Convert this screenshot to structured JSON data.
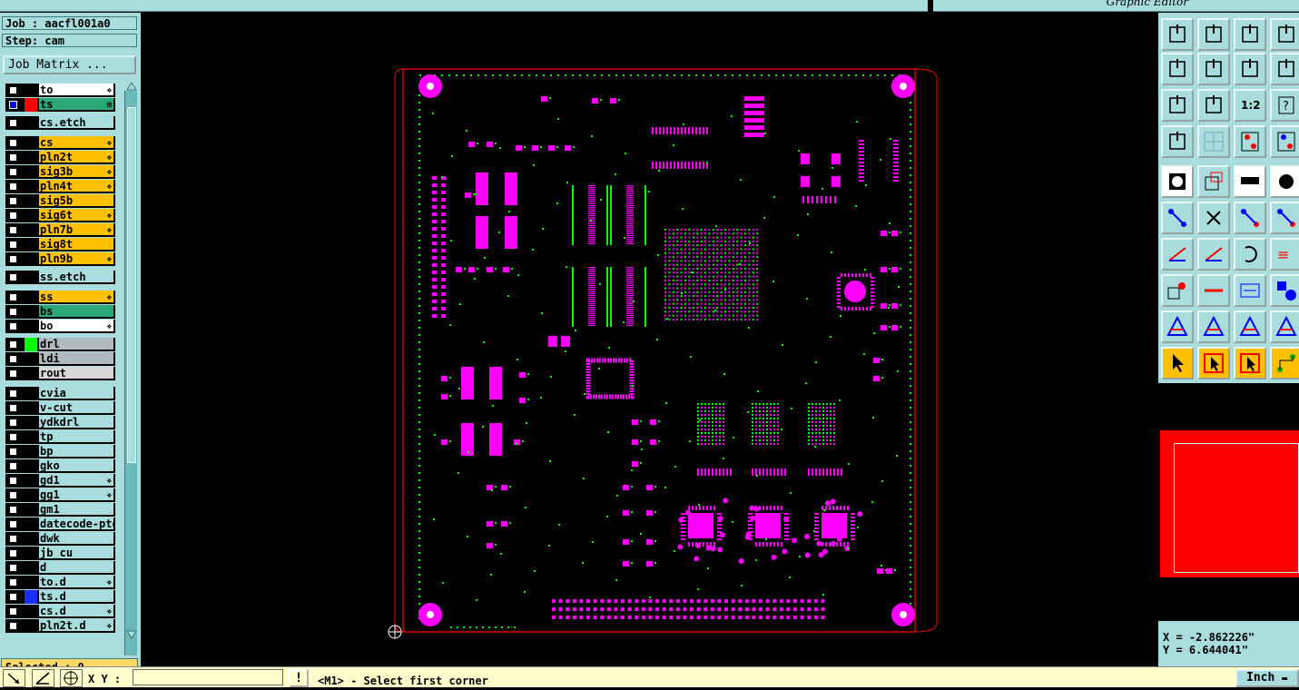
{
  "window": {
    "title": "Graphic Editor"
  },
  "job": {
    "job_label": "Job : aacfl001a0",
    "step_label": "Step: cam",
    "matrix_button": "Job Matrix ..."
  },
  "layers": [
    {
      "name": "to",
      "color": "#ffffff",
      "swatch": "",
      "mark": "❖"
    },
    {
      "name": "ts",
      "color": "#2aa878",
      "swatch": "#ff0000",
      "mark": "⊞"
    },
    {
      "name": "cs.etch",
      "color": "#a9dcdc",
      "swatch": "",
      "mark": ""
    },
    {
      "name": "cs",
      "color": "#ffc000",
      "swatch": "",
      "mark": "❖"
    },
    {
      "name": "pln2t",
      "color": "#ffc000",
      "swatch": "",
      "mark": "❖"
    },
    {
      "name": "sig3b",
      "color": "#ffc000",
      "swatch": "",
      "mark": "❖"
    },
    {
      "name": "pln4t",
      "color": "#ffc000",
      "swatch": "",
      "mark": "❖"
    },
    {
      "name": "sig5b",
      "color": "#ffc000",
      "swatch": "",
      "mark": ""
    },
    {
      "name": "sig6t",
      "color": "#ffc000",
      "swatch": "",
      "mark": "❖"
    },
    {
      "name": "pln7b",
      "color": "#ffc000",
      "swatch": "",
      "mark": "❖"
    },
    {
      "name": "sig8t",
      "color": "#ffc000",
      "swatch": "",
      "mark": ""
    },
    {
      "name": "pln9b",
      "color": "#ffc000",
      "swatch": "",
      "mark": "❖"
    },
    {
      "name": "ss.etch",
      "color": "#a9dcdc",
      "swatch": "",
      "mark": ""
    },
    {
      "name": "ss",
      "color": "#ffc000",
      "swatch": "",
      "mark": "❖"
    },
    {
      "name": "bs",
      "color": "#2aa878",
      "swatch": "",
      "mark": ""
    },
    {
      "name": "bo",
      "color": "#ffffff",
      "swatch": "",
      "mark": "❖"
    },
    {
      "name": "drl",
      "color": "#b0b8c0",
      "swatch": "#00ff00",
      "mark": ""
    },
    {
      "name": "ldi",
      "color": "#b0b8c0",
      "swatch": "",
      "mark": ""
    },
    {
      "name": "rout",
      "color": "#d8d8d8",
      "swatch": "",
      "mark": ""
    },
    {
      "name": "cvia",
      "color": "#a9dcdc",
      "swatch": "",
      "mark": ""
    },
    {
      "name": "v-cut",
      "color": "#a9dcdc",
      "swatch": "",
      "mark": ""
    },
    {
      "name": "ydkdrl",
      "color": "#a9dcdc",
      "swatch": "",
      "mark": ""
    },
    {
      "name": "tp",
      "color": "#a9dcdc",
      "swatch": "",
      "mark": ""
    },
    {
      "name": "bp",
      "color": "#a9dcdc",
      "swatch": "",
      "mark": ""
    },
    {
      "name": "gko",
      "color": "#a9dcdc",
      "swatch": "",
      "mark": ""
    },
    {
      "name": "gd1",
      "color": "#a9dcdc",
      "swatch": "",
      "mark": "❖"
    },
    {
      "name": "gg1",
      "color": "#a9dcdc",
      "swatch": "",
      "mark": "❖"
    },
    {
      "name": "gm1",
      "color": "#a9dcdc",
      "swatch": "",
      "mark": ""
    },
    {
      "name": "datecode-pte",
      "color": "#a9dcdc",
      "swatch": "",
      "mark": ""
    },
    {
      "name": "dwk",
      "color": "#a9dcdc",
      "swatch": "",
      "mark": ""
    },
    {
      "name": "jb_cu",
      "color": "#a9dcdc",
      "swatch": "",
      "mark": ""
    },
    {
      "name": "d",
      "color": "#a9dcdc",
      "swatch": "",
      "mark": ""
    },
    {
      "name": "to.d",
      "color": "#a9dcdc",
      "swatch": "",
      "mark": "❖"
    },
    {
      "name": "ts.d",
      "color": "#a9dcdc",
      "swatch": "#1a2cff",
      "mark": ""
    },
    {
      "name": "cs.d",
      "color": "#a9dcdc",
      "swatch": "",
      "mark": "❖"
    },
    {
      "name": "pln2t.d",
      "color": "#a9dcdc",
      "swatch": "",
      "mark": "❖"
    }
  ],
  "status": {
    "selected": "Selected : 0",
    "prompt": "<M1> - Select first corner"
  },
  "coords": {
    "x": "X = -2.862226\"",
    "y": "Y = 6.644041\""
  },
  "input": {
    "xy_label": "X Y :",
    "xy_value": ""
  },
  "units": {
    "selected": "Inch"
  },
  "colors": {
    "panel": "#a9dcdc",
    "pad": "#ff00ff",
    "outline": "#ff0000",
    "drill": "#00ff00",
    "accent": "#ffc000"
  },
  "toolbar": {
    "rows": [
      [
        "home-icon",
        "save-icon",
        "house-icon",
        "window-icon"
      ],
      [
        "zoom-in-icon",
        "zoom-out-icon",
        "zoom-prev-icon",
        "redraw-icon"
      ],
      [
        "fit-icon",
        "center-icon",
        "scale-1-2-icon",
        "help-icon"
      ],
      [
        "settings-icon",
        "grid-icon",
        "snap-red-icon",
        "snap-blue-icon"
      ],
      [
        "pad-icon",
        "outline-icon",
        "ruler-icon",
        "dot-icon"
      ],
      [
        "net-icon",
        "cross-icon",
        "line-end-icon",
        "arc-end-icon"
      ],
      [
        "angle-icon",
        "slash-icon",
        "rotate-icon",
        "flip-icon"
      ],
      [
        "feature-icon",
        "minus-icon",
        "measure-icon",
        "shapes-icon"
      ],
      [
        "triangle-icon",
        "text-a-icon",
        "text-a2-icon",
        "text-a3-icon"
      ],
      [
        "pointer-icon",
        "pointer-box-icon",
        "pointer-circle-icon",
        "route-icon"
      ]
    ]
  }
}
